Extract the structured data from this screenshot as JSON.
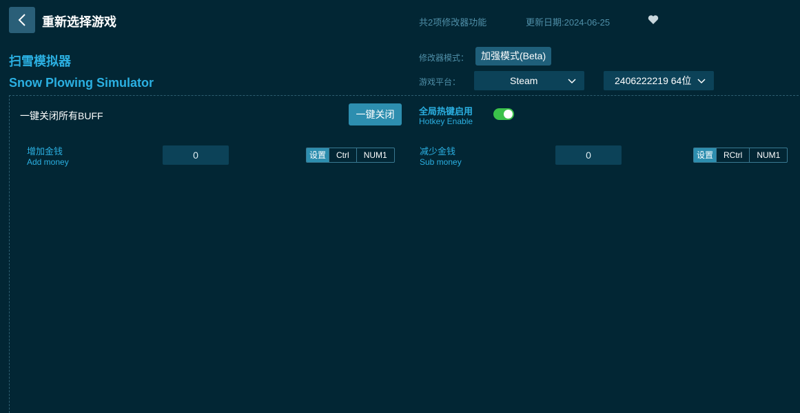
{
  "header": {
    "back_icon": "chevron-left-icon",
    "title": "重新选择游戏",
    "feature_count": "共2项修改器功能",
    "update_date": "更新日期:2024-06-25",
    "favorite_icon": "heart-icon"
  },
  "game": {
    "name_cn": "扫雪模拟器",
    "name_en": "Snow Plowing Simulator"
  },
  "settings": {
    "mode_label": "修改器模式：",
    "mode_value": "加强模式(Beta)",
    "platform_label": "游戏平台：",
    "platform_value": "Steam",
    "version_value": "2406222219 64位"
  },
  "controls": {
    "buff_label": "一键关闭所有BUFF",
    "close_all_label": "一键关闭",
    "hotkey_cn": "全局热键启用",
    "hotkey_en": "Hotkey Enable",
    "hotkey_enabled": true
  },
  "features": [
    {
      "name_cn": "增加金钱",
      "name_en": "Add money",
      "value": "0",
      "set_label": "设置",
      "key1": "Ctrl",
      "key2": "NUM1"
    },
    {
      "name_cn": "减少金钱",
      "name_en": "Sub money",
      "value": "0",
      "set_label": "设置",
      "key1": "RCtrl",
      "key2": "NUM1"
    }
  ],
  "colors": {
    "background": "#022634",
    "accent": "#2bb0e2",
    "button": "#2d8eaf",
    "toggle_on": "#3bc14a"
  }
}
